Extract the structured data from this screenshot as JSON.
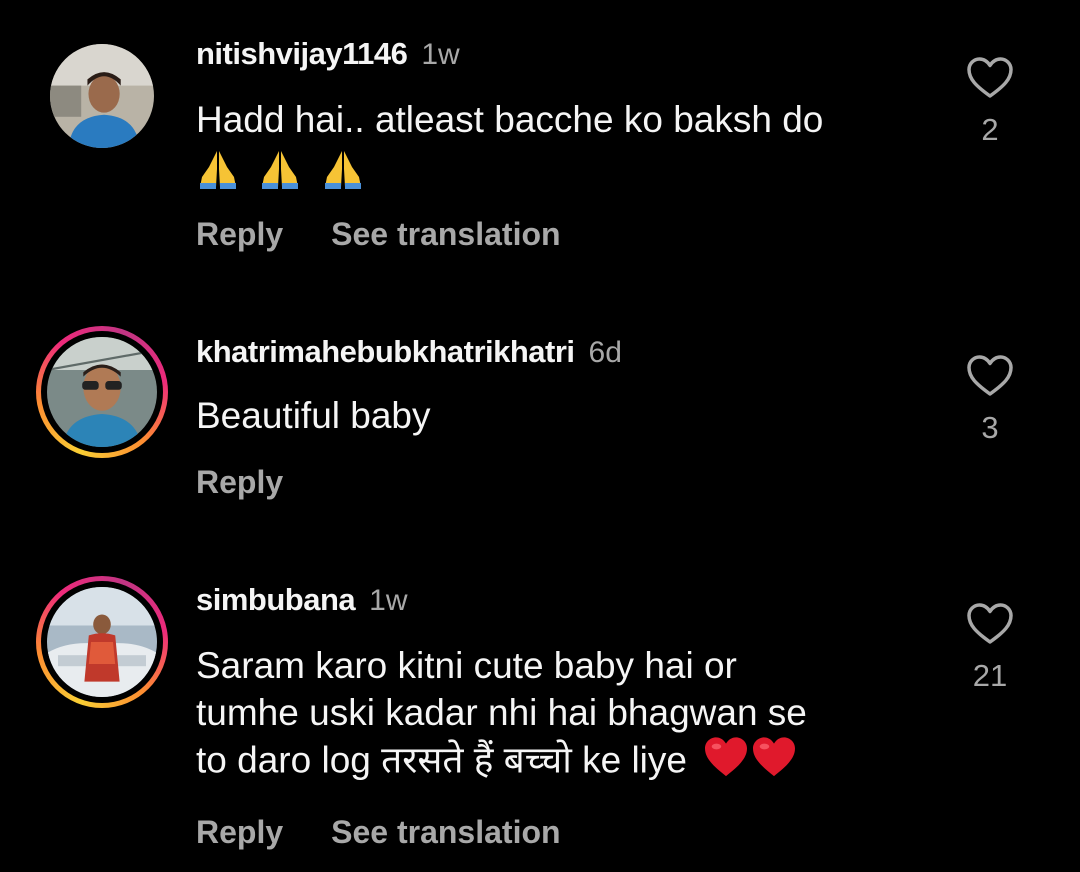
{
  "colors": {
    "background": "#000000",
    "primary_text": "#f5f5f5",
    "secondary_text": "#a8a8a8",
    "heart_emoji": "#e0192c",
    "story_ring": [
      "#f9ce34",
      "#ee2a7b",
      "#c13584"
    ]
  },
  "comments": [
    {
      "username": "nitishvijay1146",
      "time": "1w",
      "text": "Hadd hai.. atleast bacche ko baksh do",
      "emoji": [
        "folded-hands",
        "folded-hands",
        "folded-hands"
      ],
      "reply_label": "Reply",
      "translation_label": "See translation",
      "like_count": "2",
      "like_icon": "heart-outline-icon",
      "story_ring": false
    },
    {
      "username": "khatrimahebubkhatrikhatri",
      "time": "6d",
      "text": "Beautiful baby",
      "emoji": [],
      "reply_label": "Reply",
      "like_count": "3",
      "like_icon": "heart-outline-icon",
      "story_ring": true
    },
    {
      "username": "simbubana",
      "time": "1w",
      "text_line1": "Saram karo kitni cute baby hai or",
      "text_line2": "tumhe uski kadar nhi hai bhagwan se",
      "text_line3": "to daro log तरसते हैं बच्चो ke liye",
      "emoji": [
        "red-heart",
        "red-heart"
      ],
      "reply_label": "Reply",
      "translation_label": "See translation",
      "like_count": "21",
      "like_icon": "heart-outline-icon",
      "story_ring": true
    }
  ]
}
